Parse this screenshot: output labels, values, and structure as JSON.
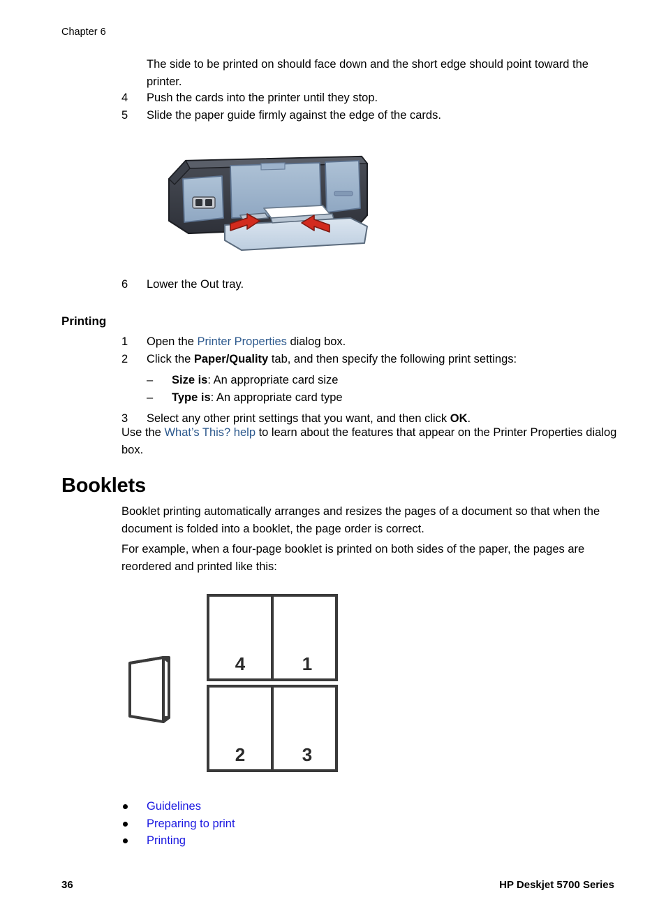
{
  "page": {
    "chapter_head": "Chapter 6",
    "page_number": "36",
    "product_name": "HP Deskjet 5700 Series"
  },
  "cards_section": {
    "intro_paragraph": "The side to be printed on should face down and the short edge should point toward the printer.",
    "steps": [
      {
        "marker": "4",
        "text": "Push the cards into the printer until they stop."
      },
      {
        "marker": "5",
        "text": "Slide the paper guide firmly against the edge of the cards."
      }
    ],
    "step_after_figure": {
      "marker": "6",
      "text": "Lower the Out tray."
    }
  },
  "printer_figure": {
    "alt": "Printer with In tray extended, red arrows showing paper guide adjustment",
    "body_color": "#3a3d45",
    "panel_color": "#9db3cc",
    "arrow_color": "#d22b1e",
    "tray_color": "#c9d6e4"
  },
  "printing_section": {
    "heading": "Printing",
    "steps": [
      {
        "marker": "1",
        "parts": [
          {
            "text": "Open the ",
            "style": "plain"
          },
          {
            "text": "Printer Properties",
            "style": "xref"
          },
          {
            "text": " dialog box.",
            "style": "plain"
          }
        ]
      },
      {
        "marker": "2",
        "parts": [
          {
            "text": "Click the ",
            "style": "plain"
          },
          {
            "text": "Paper/Quality",
            "style": "bold"
          },
          {
            "text": " tab, and then specify the following print settings:",
            "style": "plain"
          }
        ]
      }
    ],
    "sub_items": [
      {
        "marker": "–",
        "parts": [
          {
            "text": "Size is",
            "style": "bold"
          },
          {
            "text": ": An appropriate card size",
            "style": "plain"
          }
        ]
      },
      {
        "marker": "–",
        "parts": [
          {
            "text": "Type is",
            "style": "bold"
          },
          {
            "text": ": An appropriate card type",
            "style": "plain"
          }
        ]
      }
    ],
    "step3": {
      "marker": "3",
      "parts": [
        {
          "text": "Select any other print settings that you want, and then click ",
          "style": "plain"
        },
        {
          "text": "OK",
          "style": "bold"
        },
        {
          "text": ".",
          "style": "plain"
        }
      ]
    },
    "whats_this": {
      "prefix": "Use the ",
      "link": "What’s This? help",
      "suffix": " to learn about the features that appear on the Printer Properties dialog box."
    }
  },
  "booklets_section": {
    "heading": "Booklets",
    "paragraph1": "Booklet printing automatically arranges and resizes the pages of a document so that when the document is folded into a booklet, the page order is correct.",
    "paragraph2": "For example, when a four-page booklet is printed on both sides of the paper, the pages are reordered and printed like this:",
    "diagram": {
      "alt": "Folded booklet icon beside two sheets showing reordered page numbers",
      "sheet_top": {
        "left_page": "4",
        "right_page": "1"
      },
      "sheet_bottom": {
        "left_page": "2",
        "right_page": "3"
      },
      "line_color": "#3a3a3a"
    },
    "links": [
      {
        "label": "Guidelines"
      },
      {
        "label": "Preparing to print"
      },
      {
        "label": "Printing"
      }
    ]
  },
  "colors": {
    "xref_link": "#2e5a8e",
    "nav_link": "#1a18e0",
    "text": "#000000",
    "page_background": "#ffffff"
  }
}
